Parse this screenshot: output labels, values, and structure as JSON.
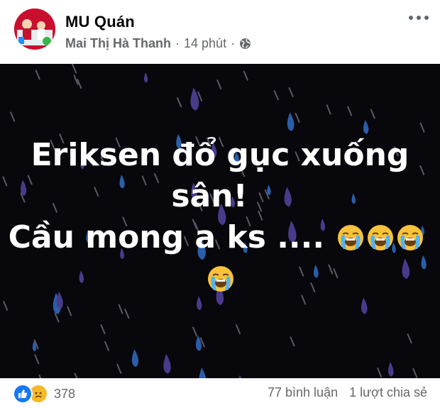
{
  "post": {
    "page_name": "MU Quán",
    "author": "Mai Thị Hà Thanh",
    "separator": "·",
    "time": "14 phút",
    "privacy_icon": "globe-icon",
    "more_icon": "more-options-icon"
  },
  "image_text": {
    "line1": "Eriksen đổ gục xuống",
    "line2": "sân!",
    "line3": "Cầu mong a ks ....",
    "emoji": "loudly-crying-face"
  },
  "footer": {
    "reaction_icons": [
      "like-icon",
      "sad-icon"
    ],
    "reaction_count": "378",
    "comments": "77 bình luận",
    "shares": "1 lượt chia sẻ"
  },
  "colors": {
    "background_image": "#07070c",
    "raindrop_purple": "#4a3a8a",
    "raindrop_blue": "#2b5ea8",
    "streak": "#5a5a66",
    "meta_text": "#65676b",
    "like_blue": "#1877f2"
  }
}
